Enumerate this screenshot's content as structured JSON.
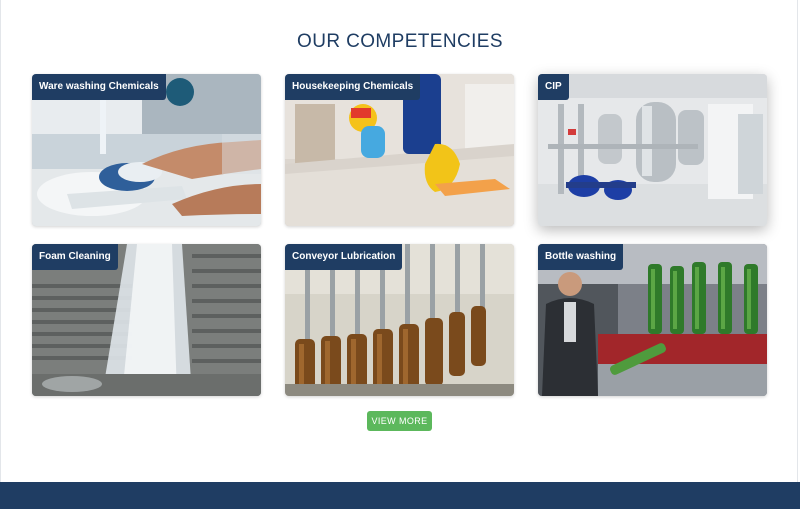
{
  "section": {
    "title": "OUR COMPETENCIES"
  },
  "cards": [
    {
      "label": "Ware washing Chemicals"
    },
    {
      "label": "Housekeeping Chemicals"
    },
    {
      "label": "CIP"
    },
    {
      "label": "Foam Cleaning"
    },
    {
      "label": "Conveyor Lubrication"
    },
    {
      "label": "Bottle washing"
    }
  ],
  "view_more": {
    "label": "VIEW MORE"
  },
  "colors": {
    "navy": "#1f3d63",
    "button_green": "#5cb85c",
    "background": "#ffffff"
  }
}
